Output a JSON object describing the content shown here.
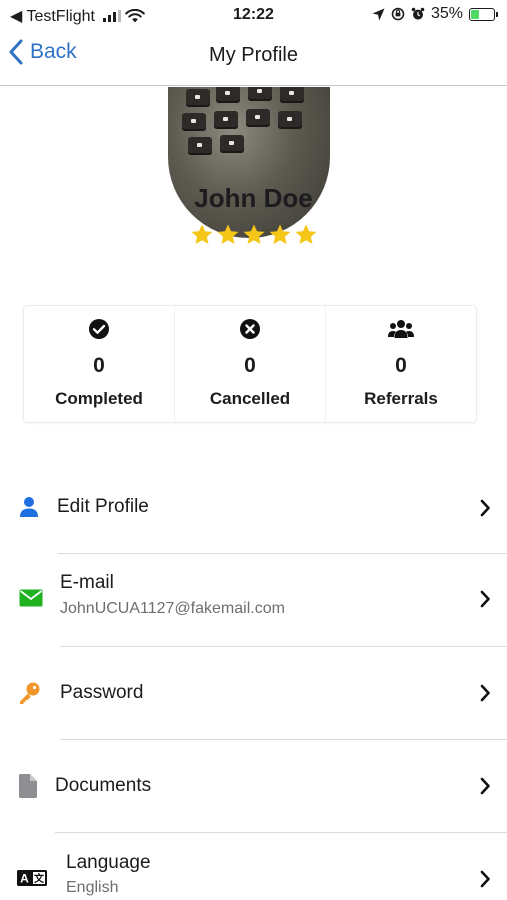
{
  "status_bar": {
    "back_app": "◀ TestFlight",
    "time": "12:22",
    "battery": "35%"
  },
  "nav": {
    "back_label": "Back",
    "title": "My Profile"
  },
  "profile": {
    "name": "John Doe",
    "rating": 5
  },
  "stats": [
    {
      "icon": "check-circle-icon",
      "value": "0",
      "label": "Completed"
    },
    {
      "icon": "x-circle-icon",
      "value": "0",
      "label": "Cancelled"
    },
    {
      "icon": "users-icon",
      "value": "0",
      "label": "Referrals"
    }
  ],
  "menu": {
    "edit_profile": {
      "title": "Edit Profile"
    },
    "email": {
      "title": "E-mail",
      "subtitle": "JohnUCUA1127@fakemail.com"
    },
    "password": {
      "title": "Password"
    },
    "documents": {
      "title": "Documents"
    },
    "language": {
      "title": "Language",
      "subtitle": "English"
    }
  },
  "colors": {
    "accent_blue": "#2f72c4",
    "star": "#f5c518",
    "user_icon": "#1e6fe0",
    "mail_icon": "#1fb11f",
    "key_icon": "#f0962a",
    "doc_icon": "#8e8e93"
  }
}
